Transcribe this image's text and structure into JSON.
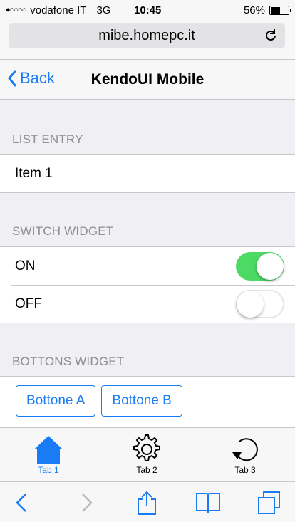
{
  "status_bar": {
    "signal": "●○○○○",
    "carrier": "vodafone IT",
    "network": "3G",
    "time": "10:45",
    "battery_text": "56%",
    "battery_level": 0.56
  },
  "browser": {
    "url": "mibe.homepc.it"
  },
  "nav": {
    "back_label": "Back",
    "title": "KendoUI Mobile"
  },
  "sections": {
    "list_entry": {
      "header": "LIST ENTRY",
      "items": [
        "Item 1"
      ]
    },
    "switch_widget": {
      "header": "SWITCH WIDGET",
      "rows": [
        {
          "label": "ON",
          "state": true
        },
        {
          "label": "OFF",
          "state": false
        }
      ]
    },
    "buttons_widget": {
      "header": "BOTTONS WIDGET",
      "buttons": [
        "Bottone A",
        "Bottone B"
      ]
    }
  },
  "tabstrip": {
    "tabs": [
      {
        "label": "Tab 1",
        "icon": "home-icon",
        "active": true
      },
      {
        "label": "Tab 2",
        "icon": "gear-icon",
        "active": false
      },
      {
        "label": "Tab 3",
        "icon": "undo-icon",
        "active": false
      }
    ]
  },
  "colors": {
    "accent": "#1a7cf5",
    "switch_on": "#4cd964",
    "section_header": "#8e8e93",
    "background": "#efeff4"
  }
}
